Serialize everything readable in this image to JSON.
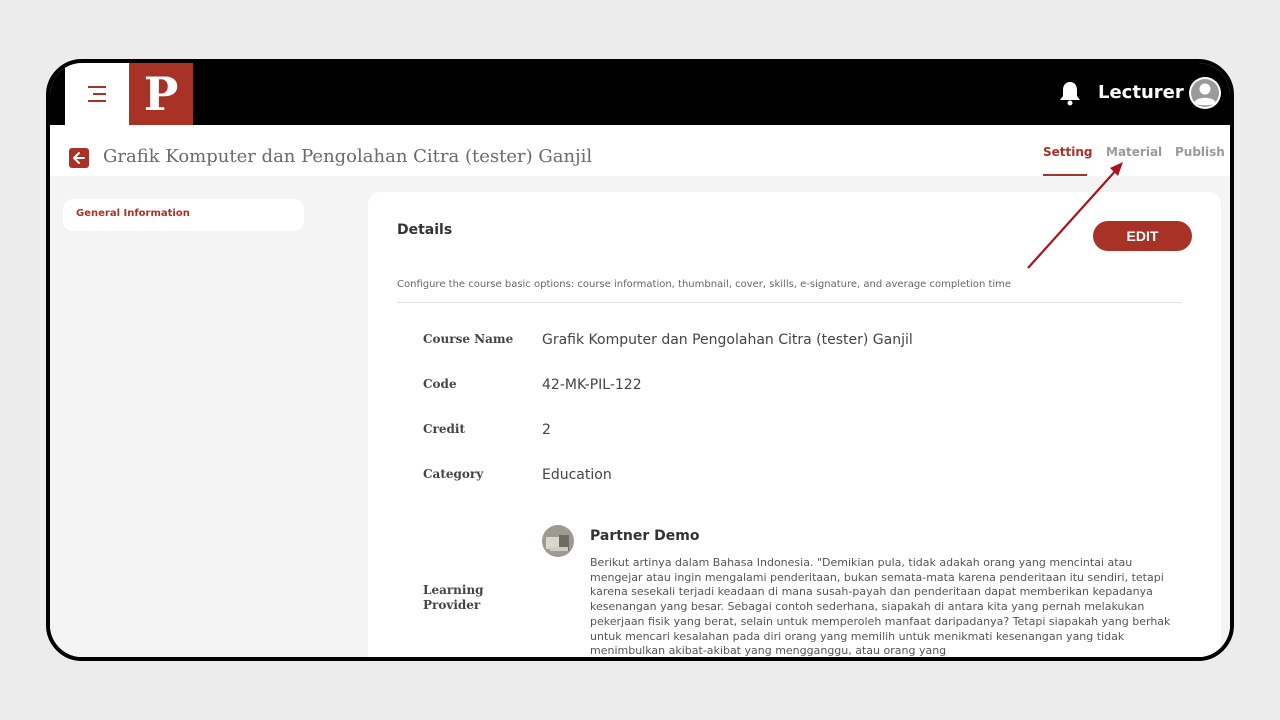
{
  "topbar": {
    "logo_letter": "P",
    "user_label": "Lecturer",
    "icons": {
      "menu": "menu-icon",
      "bell": "bell-icon",
      "avatar": "user-avatar-icon"
    }
  },
  "header": {
    "title": "Grafik Komputer dan Pengolahan Citra (tester) Ganjil",
    "tabs": [
      {
        "label": "Setting",
        "active": true
      },
      {
        "label": "Material",
        "active": false
      },
      {
        "label": "Publish",
        "active": false
      }
    ]
  },
  "sidebar": {
    "items": [
      {
        "label": "General Information",
        "active": true
      }
    ]
  },
  "details": {
    "title": "Details",
    "edit_label": "EDIT",
    "description": "Configure the course basic options: course information, thumbnail, cover, skills, e-signature, and average completion time",
    "fields": [
      {
        "label": "Course Name",
        "value": "Grafik Komputer dan Pengolahan Citra (tester) Ganjil"
      },
      {
        "label": "Code",
        "value": "42-MK-PIL-122"
      },
      {
        "label": "Credit",
        "value": "2"
      },
      {
        "label": "Category",
        "value": "Education"
      }
    ],
    "provider": {
      "label_line1": "Learning",
      "label_line2": "Provider",
      "name": "Partner Demo",
      "description": "Berikut artinya dalam Bahasa Indonesia. \"Demikian pula, tidak adakah orang yang mencintai atau mengejar atau ingin mengalami penderitaan, bukan semata-mata karena penderitaan itu sendiri, tetapi karena sesekali terjadi keadaan di mana susah-payah dan penderitaan dapat memberikan kepadanya kesenangan yang besar. Sebagai contoh sederhana, siapakah di antara kita yang pernah melakukan pekerjaan fisik yang berat, selain untuk memperoleh manfaat daripadanya? Tetapi siapakah yang berhak untuk mencari kesalahan pada diri orang yang memilih untuk menikmati kesenangan yang tidak menimbulkan akibat-akibat yang mengganggu, atau orang yang"
    }
  },
  "colors": {
    "brand": "#a93226",
    "topbar": "#000000",
    "content_bg": "#f4f4f4"
  }
}
